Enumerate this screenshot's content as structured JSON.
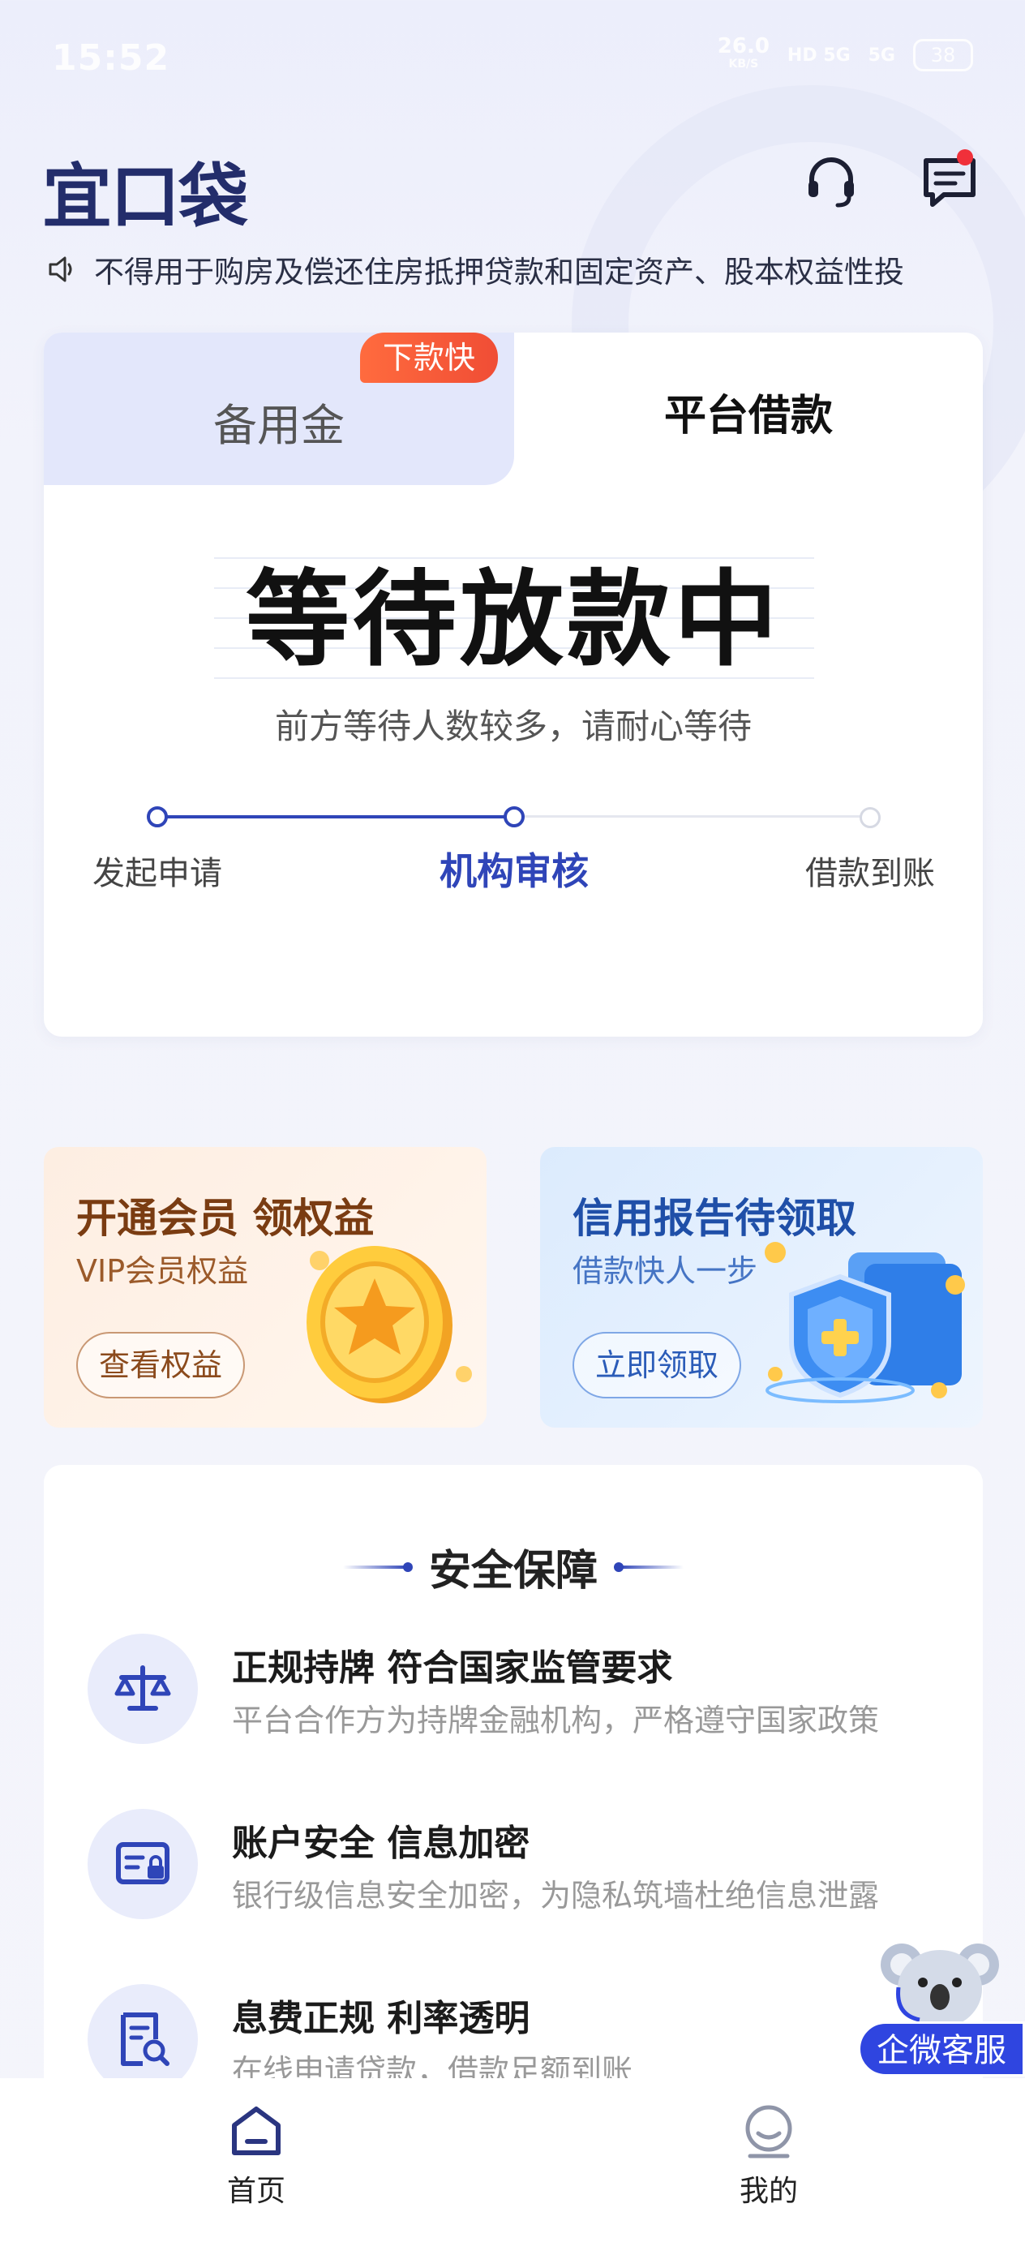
{
  "status_bar": {
    "time": "15:52",
    "speed": "26.0",
    "speed_unit": "KB/S",
    "signal_1": "HD 5G",
    "signal_2": "5G",
    "battery": "38"
  },
  "header": {
    "logo": "宜口袋",
    "icons": [
      "headset-icon",
      "message-icon"
    ],
    "message_has_badge": true
  },
  "notice": {
    "icon": "speaker-icon",
    "text": "不得用于购房及偿还住房抵押贷款和固定资产、股本权益性投"
  },
  "loan_card": {
    "tabs": [
      {
        "label": "备用金",
        "active": false
      },
      {
        "label": "平台借款",
        "active": true
      }
    ],
    "tag": "下款快",
    "status_title": "等待放款中",
    "status_sub": "前方等待人数较多，请耐心等待",
    "steps": [
      {
        "label": "发起申请",
        "state": "done"
      },
      {
        "label": "机构审核",
        "state": "current"
      },
      {
        "label": "借款到账",
        "state": "todo"
      }
    ]
  },
  "promos": [
    {
      "title": "开通会员 领权益",
      "subtitle": "VIP会员权益",
      "button": "查看权益",
      "icon": "gold-star-coin-icon"
    },
    {
      "title": "信用报告待领取",
      "subtitle": "借款快人一步",
      "button": "立即领取",
      "icon": "shield-report-icon"
    }
  ],
  "security": {
    "title": "安全保障",
    "items": [
      {
        "title": "正规持牌 符合国家监管要求",
        "desc": "平台合作方为持牌金融机构，严格遵守国家政策",
        "icon": "scale-icon"
      },
      {
        "title": "账户安全 信息加密",
        "desc": "银行级信息安全加密，为隐私筑墙杜绝信息泄露",
        "icon": "secure-card-icon"
      },
      {
        "title": "息费正规  利率透明",
        "desc": "在线申请贷款，借款足额到账",
        "icon": "document-search-icon"
      }
    ]
  },
  "float_service": {
    "label": "企微客服",
    "icon": "koala-mascot-icon"
  },
  "bottom_nav": [
    {
      "label": "首页",
      "icon": "home-icon",
      "active": true
    },
    {
      "label": "我的",
      "icon": "profile-icon",
      "active": false
    }
  ],
  "colors": {
    "accent": "#2f45b8",
    "tag": "#f04d35",
    "float_button": "#2f45e0"
  }
}
